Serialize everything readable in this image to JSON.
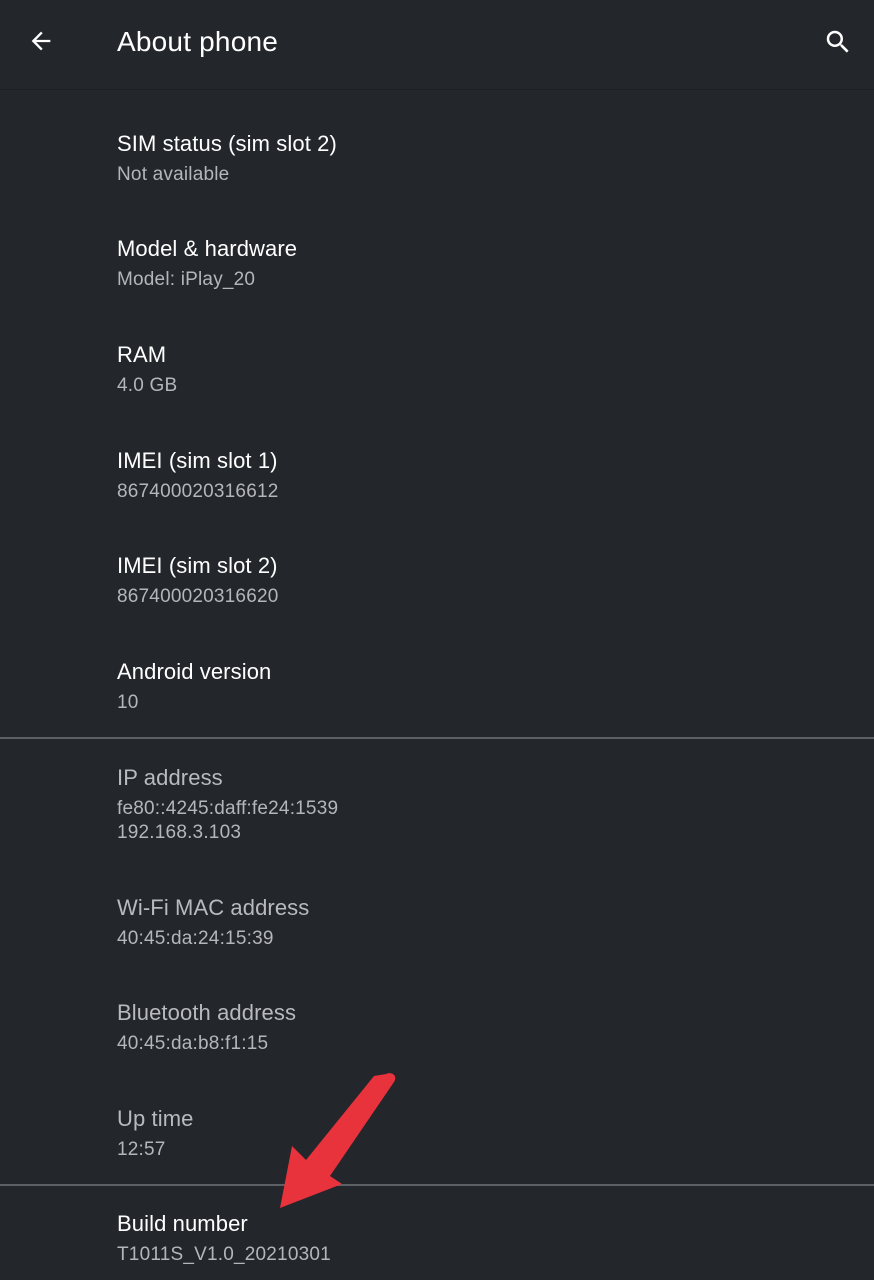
{
  "header": {
    "title": "About phone",
    "back_icon": "arrow-back-icon",
    "search_icon": "search-icon"
  },
  "items": [
    {
      "label": "SIM status (sim slot 2)",
      "value": "Not available"
    },
    {
      "label": "Model & hardware",
      "value": "Model: iPlay_20"
    },
    {
      "label": "RAM",
      "value": "4.0 GB"
    },
    {
      "label": "IMEI (sim slot 1)",
      "value": "867400020316612"
    },
    {
      "label": "IMEI (sim slot 2)",
      "value": "867400020316620"
    },
    {
      "label": "Android version",
      "value": "10"
    },
    {
      "label": "IP address",
      "value_line1": "fe80::4245:daff:fe24:1539",
      "value_line2": "192.168.3.103"
    },
    {
      "label": "Wi-Fi MAC address",
      "value": "40:45:da:24:15:39"
    },
    {
      "label": "Bluetooth address",
      "value": "40:45:da:b8:f1:15"
    },
    {
      "label": "Up time",
      "value": "12:57"
    },
    {
      "label": "Build number",
      "value": "T1011S_V1.0_20210301"
    }
  ],
  "colors": {
    "background": "#23262b",
    "primary_text": "#ffffff",
    "secondary_text": "#b4b6b9",
    "annotation_arrow": "#e8323c"
  }
}
